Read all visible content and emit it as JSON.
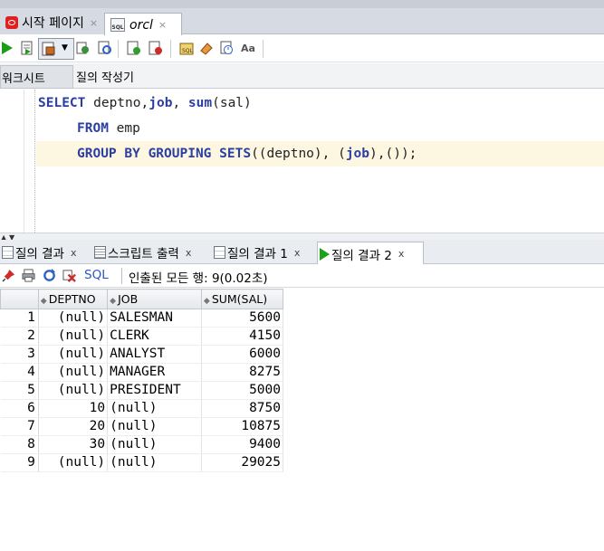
{
  "tabs": [
    {
      "label": "시작 페이지",
      "close": "×",
      "icon": "oracle-icon"
    },
    {
      "label": "orcl",
      "close": "×",
      "icon": "sql-worksheet-icon"
    }
  ],
  "subtabs": {
    "worksheet": "워크시트",
    "query_builder": "질의 작성기"
  },
  "editor": {
    "line1": {
      "kw1": "SELECT",
      "t1": " deptno,",
      "kw2": "job",
      "t2": ", ",
      "kw3": "sum",
      "t3": "(sal)"
    },
    "line2": {
      "kw1": "FROM",
      "t1": " emp"
    },
    "line3": {
      "kw1": "GROUP BY GROUPING SETS",
      "t1": "((deptno), (",
      "kw2": "job",
      "t2": "),());"
    }
  },
  "result_tabs": [
    {
      "label": "질의 결과",
      "close": "x"
    },
    {
      "label": "스크립트 출력",
      "close": "x"
    },
    {
      "label": "질의 결과 1",
      "close": "x"
    },
    {
      "label": "질의 결과 2",
      "close": "x"
    }
  ],
  "result_toolbar": {
    "sql_label": "SQL",
    "status": "인출된 모든 행: 9(0.02초)"
  },
  "grid": {
    "columns": [
      "DEPTNO",
      "JOB",
      "SUM(SAL)"
    ],
    "rows": [
      {
        "n": "1",
        "deptno": "(null)",
        "job": "SALESMAN",
        "sum": "5600"
      },
      {
        "n": "2",
        "deptno": "(null)",
        "job": "CLERK",
        "sum": "4150"
      },
      {
        "n": "3",
        "deptno": "(null)",
        "job": "ANALYST",
        "sum": "6000"
      },
      {
        "n": "4",
        "deptno": "(null)",
        "job": "MANAGER",
        "sum": "8275"
      },
      {
        "n": "5",
        "deptno": "(null)",
        "job": "PRESIDENT",
        "sum": "5000"
      },
      {
        "n": "6",
        "deptno": "10",
        "job": "(null)",
        "sum": "8750"
      },
      {
        "n": "7",
        "deptno": "20",
        "job": "(null)",
        "sum": "10875"
      },
      {
        "n": "8",
        "deptno": "30",
        "job": "(null)",
        "sum": "9400"
      },
      {
        "n": "9",
        "deptno": "(null)",
        "job": "(null)",
        "sum": "29025"
      }
    ]
  }
}
